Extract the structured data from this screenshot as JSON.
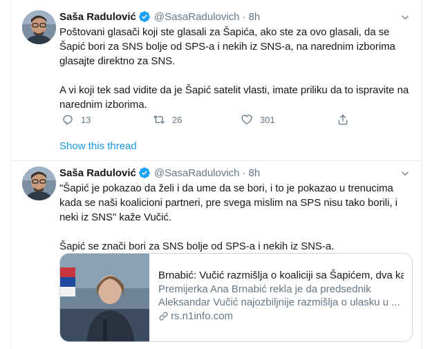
{
  "tweets": [
    {
      "author": {
        "display_name": "Saša Radulović",
        "handle": "@SasaRadulovich",
        "verified": true
      },
      "separator": "·",
      "time": "8h",
      "text": "Poštovani glasači koji ste glasali za Šapića, ako ste za ovo glasali, da se Šapić bori za SNS bolje od SPS-a i nekih iz SNS-a, na narednim izborima glasajte direktno za SNS.\n\nA vi koji tek sad vidite da je Šapić satelit vlasti, imate priliku da to ispravite na narednim izborima.",
      "actions": {
        "replies": "13",
        "retweets": "26",
        "likes": "301"
      },
      "show_thread": "Show this thread"
    },
    {
      "author": {
        "display_name": "Saša Radulović",
        "handle": "@SasaRadulovich",
        "verified": true
      },
      "separator": "·",
      "time": "8h",
      "text": "\"Šapić je pokazao da želi i da ume da se bori, i to je pokazao u trenucima kada se naši koalicioni partneri, pre svega mislim na SPS nisu tako borili, i neki iz SNS\" kaže Vučić.\n\nŠapić se znači bori za SNS bolje od SPS-a i nekih iz SNS-a.",
      "card": {
        "title": "Brnabić: Vučić razmišlja o koaliciji sa Šapićem, dva ka...",
        "description": "Premijerka Ana Brnabić rekla je da predsednik Aleksandar Vučić najozbiljnije razmišlja o ulasku u ...",
        "domain": "rs.n1info.com"
      }
    }
  ],
  "colors": {
    "link": "#1b95e0",
    "muted": "#657786",
    "text": "#14171a",
    "border": "#e6ecf0",
    "verified": "#1da1f2"
  },
  "icons": [
    "caret-down-icon",
    "verified-badge-icon",
    "reply-icon",
    "retweet-icon",
    "like-icon",
    "share-icon",
    "link-icon"
  ]
}
